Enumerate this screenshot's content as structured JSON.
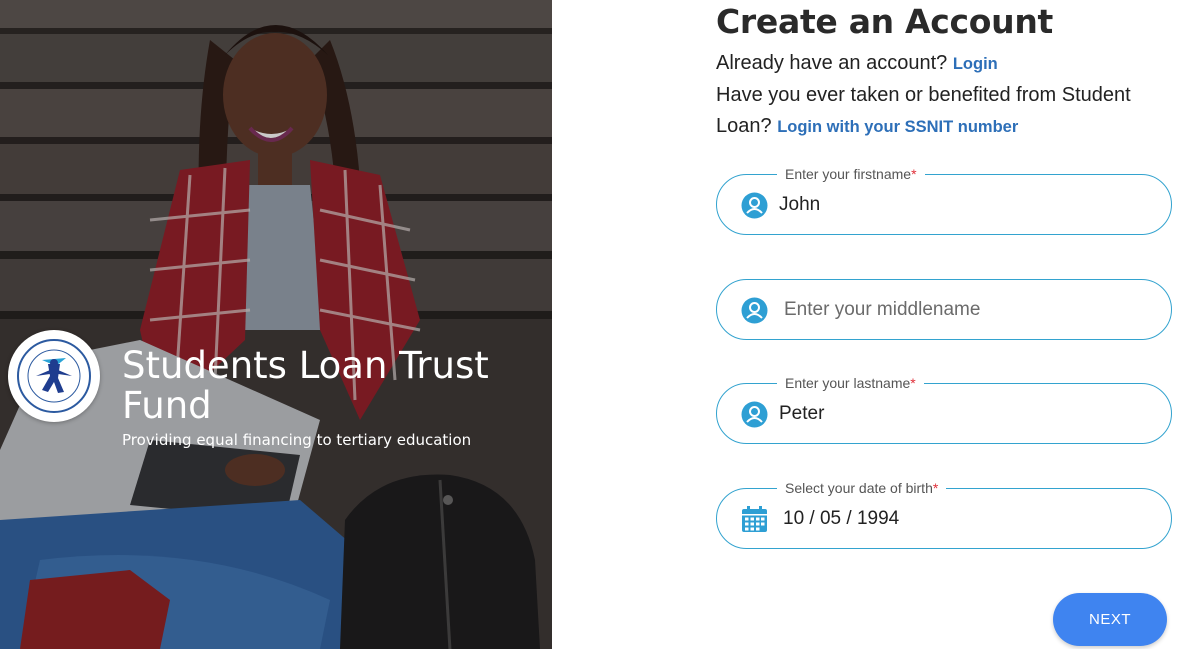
{
  "hero": {
    "org_name": "Students Loan Trust Fund",
    "tagline": "Providing equal financing to tertiary education",
    "logo_icon": "slt-logo-icon",
    "logo_text": "STUDENTS LOAN TRUST FUND"
  },
  "form": {
    "title": "Create an Account",
    "have_account_text": "Already have an account?",
    "login_link": "Login",
    "ssnit_text": "Have you ever taken or benefited from Student Loan?",
    "ssnit_link": "Login with your SSNIT number",
    "fields": {
      "firstname": {
        "label": "Enter your firstname",
        "value": "John",
        "placeholder": "Enter your firstname",
        "icon": "user-icon"
      },
      "middlename": {
        "label": "",
        "value": "",
        "placeholder": "Enter your middlename",
        "icon": "user-icon"
      },
      "lastname": {
        "label": "Enter your lastname",
        "value": "Peter",
        "placeholder": "Enter your lastname",
        "icon": "user-icon"
      },
      "dob": {
        "label": "Select your date of birth",
        "value": "10 / 05 / 1994",
        "placeholder": "Select your date of birth",
        "icon": "calendar-icon"
      }
    },
    "required_mark": "*",
    "next_label": "NEXT"
  },
  "colors": {
    "accent": "#33a3cf",
    "link": "#2d6fb8",
    "button": "#3f84f0",
    "required": "#e0303a"
  }
}
